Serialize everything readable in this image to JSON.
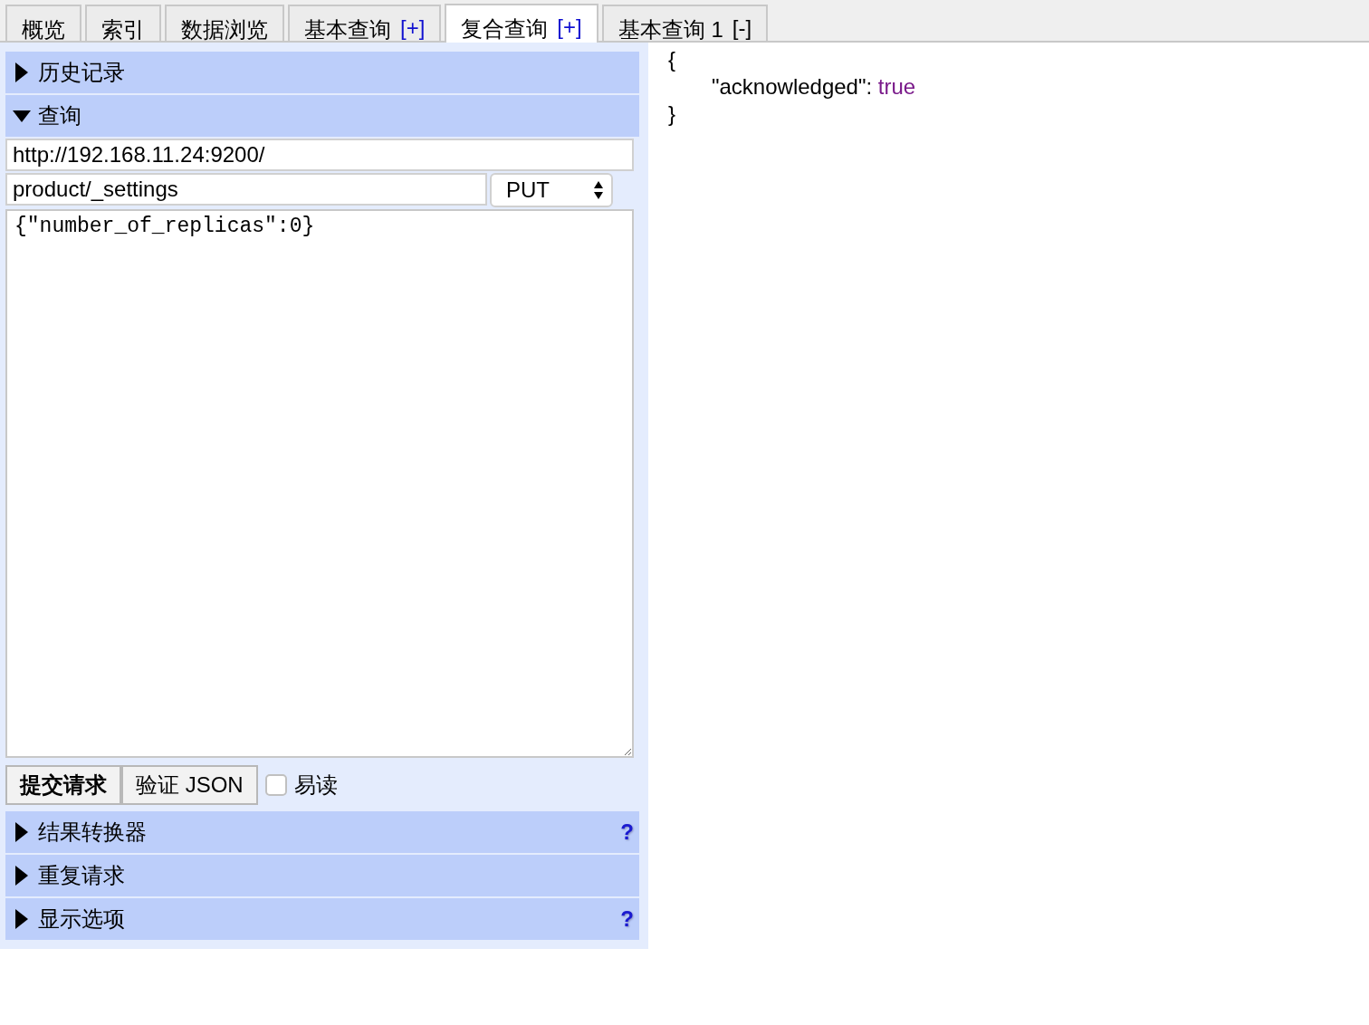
{
  "tabs": [
    {
      "label": "概览",
      "selected": false
    },
    {
      "label": "索引",
      "selected": false
    },
    {
      "label": "数据浏览",
      "selected": false
    },
    {
      "label": "基本查询",
      "suffix": "[+]",
      "selected": false
    },
    {
      "label": "复合查询",
      "suffix": "[+]",
      "selected": true
    },
    {
      "label": "基本查询 1",
      "suffix": "[-]",
      "selected": false
    }
  ],
  "sections_top": [
    {
      "title": "历史记录",
      "expanded": false
    },
    {
      "title": "查询",
      "expanded": true
    }
  ],
  "query": {
    "server": "http://192.168.11.24:9200/",
    "path": "product/_settings",
    "method": "PUT",
    "body": "{\"number_of_replicas\":0}"
  },
  "buttons": [
    "提交请求",
    "验证 JSON"
  ],
  "pretty": {
    "label": "易读",
    "checked": false
  },
  "sections_bottom": [
    {
      "title": "结果转换器",
      "expanded": false,
      "help": "?"
    },
    {
      "title": "重复请求",
      "expanded": false
    },
    {
      "title": "显示选项",
      "expanded": false,
      "help": "?"
    }
  ],
  "result": {
    "open": "{",
    "entries": [
      {
        "key": "\"acknowledged\"",
        "sep": ":",
        "value": "true"
      }
    ],
    "close": "}"
  }
}
